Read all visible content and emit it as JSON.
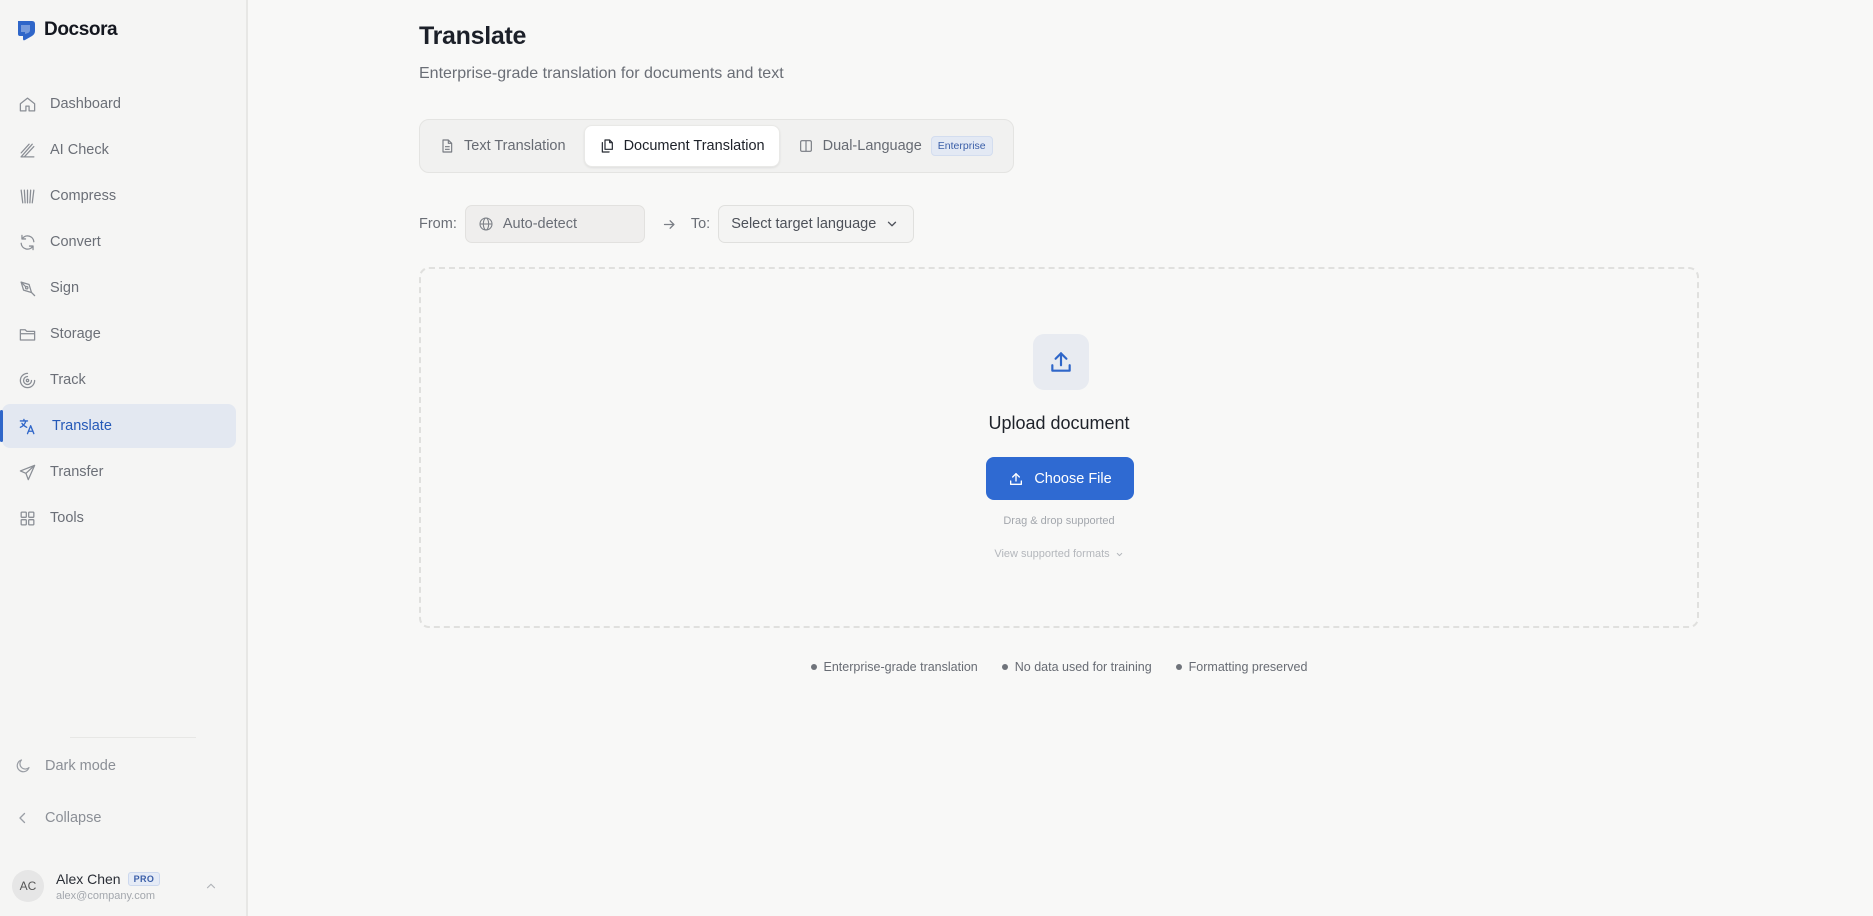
{
  "app": {
    "name": "Docsora"
  },
  "sidebar": {
    "items": [
      {
        "label": "Dashboard",
        "icon": "home-icon"
      },
      {
        "label": "AI Check",
        "icon": "ai-check-icon"
      },
      {
        "label": "Compress",
        "icon": "compress-icon"
      },
      {
        "label": "Convert",
        "icon": "refresh-icon"
      },
      {
        "label": "Sign",
        "icon": "pen-icon"
      },
      {
        "label": "Storage",
        "icon": "folder-icon"
      },
      {
        "label": "Track",
        "icon": "track-icon"
      },
      {
        "label": "Translate",
        "icon": "translate-icon",
        "active": true
      },
      {
        "label": "Transfer",
        "icon": "send-icon"
      },
      {
        "label": "Tools",
        "icon": "grid-icon"
      }
    ],
    "dark_mode_label": "Dark mode",
    "collapse_label": "Collapse",
    "user": {
      "initials": "AC",
      "name": "Alex Chen",
      "badge": "PRO",
      "email": "alex@company.com"
    }
  },
  "page": {
    "title": "Translate",
    "subtitle": "Enterprise-grade translation for documents and text"
  },
  "tabs": [
    {
      "label": "Text Translation",
      "icon": "file-text-icon"
    },
    {
      "label": "Document Translation",
      "icon": "documents-icon",
      "active": true
    },
    {
      "label": "Dual-Language",
      "icon": "columns-icon",
      "badge": "Enterprise"
    }
  ],
  "language": {
    "from_label": "From:",
    "from_value": "Auto-detect",
    "to_label": "To:",
    "to_placeholder": "Select target language"
  },
  "upload": {
    "title": "Upload document",
    "button_label": "Choose File",
    "drag_note": "Drag & drop supported",
    "formats_link": "View supported formats"
  },
  "features": [
    "Enterprise-grade translation",
    "No data used for training",
    "Formatting preserved"
  ],
  "colors": {
    "accent": "#2f6ad2",
    "active_nav_bg": "#e3e8f1",
    "active_nav_text": "#2559b8"
  }
}
